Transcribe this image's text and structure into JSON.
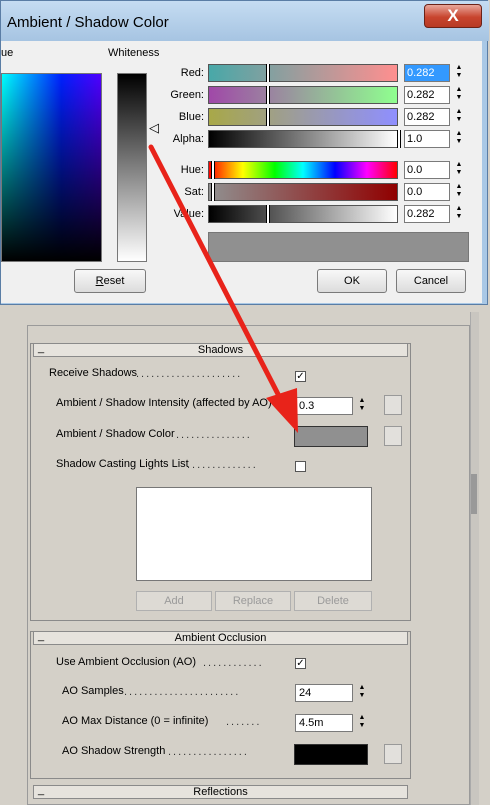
{
  "dialog": {
    "title": "Ambient / Shadow Color",
    "close_glyph": "X",
    "hue_label": "ue",
    "whiteness_label": "Whiteness",
    "channels": [
      {
        "label": "Red:",
        "value": "0.282",
        "selected": true
      },
      {
        "label": "Green:",
        "value": "0.282"
      },
      {
        "label": "Blue:",
        "value": "0.282"
      },
      {
        "label": "Alpha:",
        "value": "1.0"
      },
      {
        "label": "Hue:",
        "value": "0.0"
      },
      {
        "label": "Sat:",
        "value": "0.0"
      },
      {
        "label": "Value:",
        "value": "0.282"
      }
    ],
    "reset_label": "Reset",
    "ok_label": "OK",
    "cancel_label": "Cancel",
    "preview_color": "#909090"
  },
  "shadows": {
    "title": "Shadows",
    "collapse": "_",
    "receive_shadows": {
      "label": "Receive Shadows",
      "checked": true
    },
    "intensity": {
      "label": "Ambient / Shadow Intensity (affected by AO)",
      "value": "0.3"
    },
    "shadow_color": {
      "label": "Ambient / Shadow Color",
      "color": "#909090"
    },
    "casting_lights": {
      "label": "Shadow Casting Lights List",
      "checked": false
    },
    "add_label": "Add",
    "replace_label": "Replace",
    "delete_label": "Delete"
  },
  "ao": {
    "title": "Ambient Occlusion",
    "collapse": "_",
    "use_ao": {
      "label": "Use Ambient Occlusion (AO)",
      "checked": true
    },
    "samples": {
      "label": "AO Samples",
      "value": "24"
    },
    "max_distance": {
      "label": "AO Max Distance (0 = infinite)",
      "value": "4.5m"
    },
    "shadow_strength": {
      "label": "AO Shadow Strength",
      "color": "#000000"
    }
  },
  "reflections": {
    "title": "Reflections",
    "collapse": "_"
  },
  "colors": {
    "arrow": "#e8231a",
    "dialog_frame": "#a9c8e6",
    "close_button": "#c8452f"
  }
}
